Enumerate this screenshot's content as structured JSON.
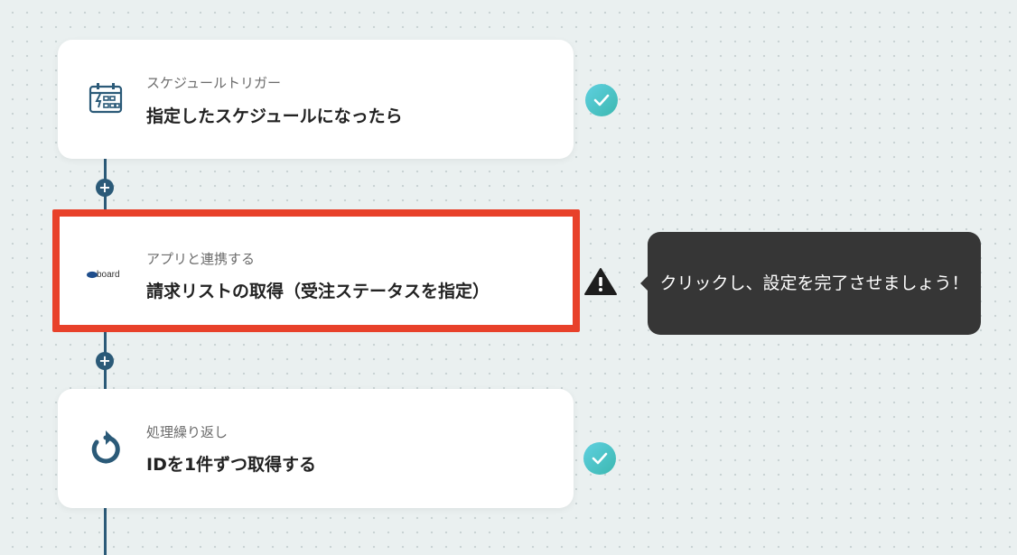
{
  "flow": {
    "steps": [
      {
        "subtitle": "スケジュールトリガー",
        "title": "指定したスケジュールになったら",
        "icon": "schedule-trigger-icon",
        "status": "complete"
      },
      {
        "subtitle": "アプリと連携する",
        "title": "請求リストの取得（受注ステータスを指定）",
        "icon": "board-app-logo",
        "logo_text": "board",
        "status": "warning",
        "highlighted": true
      },
      {
        "subtitle": "処理繰り返し",
        "title": "IDを1件ずつ取得する",
        "icon": "loop-icon",
        "status": "complete"
      }
    ],
    "add_step_label": "+"
  },
  "tooltip": {
    "text": "クリックし、設定を完了させましょう！"
  },
  "colors": {
    "background": "#eaf0f0",
    "connector": "#2b5a78",
    "highlight_border": "#e8412a",
    "check_badge": "#4cc6c8",
    "tooltip_bg": "#363636"
  }
}
